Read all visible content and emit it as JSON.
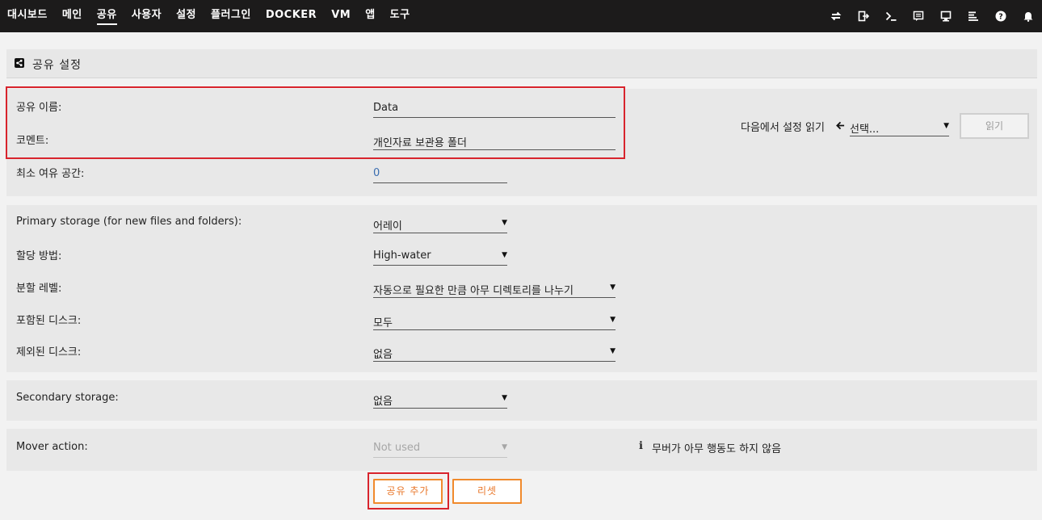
{
  "nav": {
    "items": [
      "대시보드",
      "메인",
      "공유",
      "사용자",
      "설정",
      "플러그인",
      "DOCKER",
      "VM",
      "앱",
      "도구"
    ],
    "active_index": 2
  },
  "top_icons": [
    "sync-icon",
    "logout-icon",
    "terminal-icon",
    "feedback-icon",
    "monitor-icon",
    "log-icon",
    "help-icon",
    "bell-icon"
  ],
  "page": {
    "title": "공유 설정"
  },
  "share": {
    "name_label": "공유 이름:",
    "name_value": "Data",
    "comment_label": "코멘트:",
    "comment_value": "개인자료 보관용 폴더",
    "min_free_label": "최소 여유 공간:",
    "min_free_value": "0",
    "read_settings_label": "다음에서 설정 읽기",
    "read_settings_select": "선택...",
    "read_button": "읽기"
  },
  "storage": {
    "primary_label": "Primary storage (for new files and folders):",
    "primary_value": "어레이",
    "allocation_label": "할당 방법:",
    "allocation_value": "High-water",
    "split_label": "분할 레벨:",
    "split_value": "자동으로 필요한 만큼 아무 디렉토리를 나누기",
    "included_label": "포함된 디스크:",
    "included_value": "모두",
    "excluded_label": "제외된 디스크:",
    "excluded_value": "없음"
  },
  "secondary": {
    "label": "Secondary storage:",
    "value": "없음"
  },
  "mover": {
    "label": "Mover action:",
    "value": "Not used",
    "info": "무버가 아무 행동도 하지 않음"
  },
  "buttons": {
    "add_share": "공유 추가",
    "reset": "리셋"
  },
  "colors": {
    "topbar": "#1c1b1b",
    "accent": "#f08a2c",
    "highlight": "#d8242d",
    "numeric": "#3a6db0"
  }
}
